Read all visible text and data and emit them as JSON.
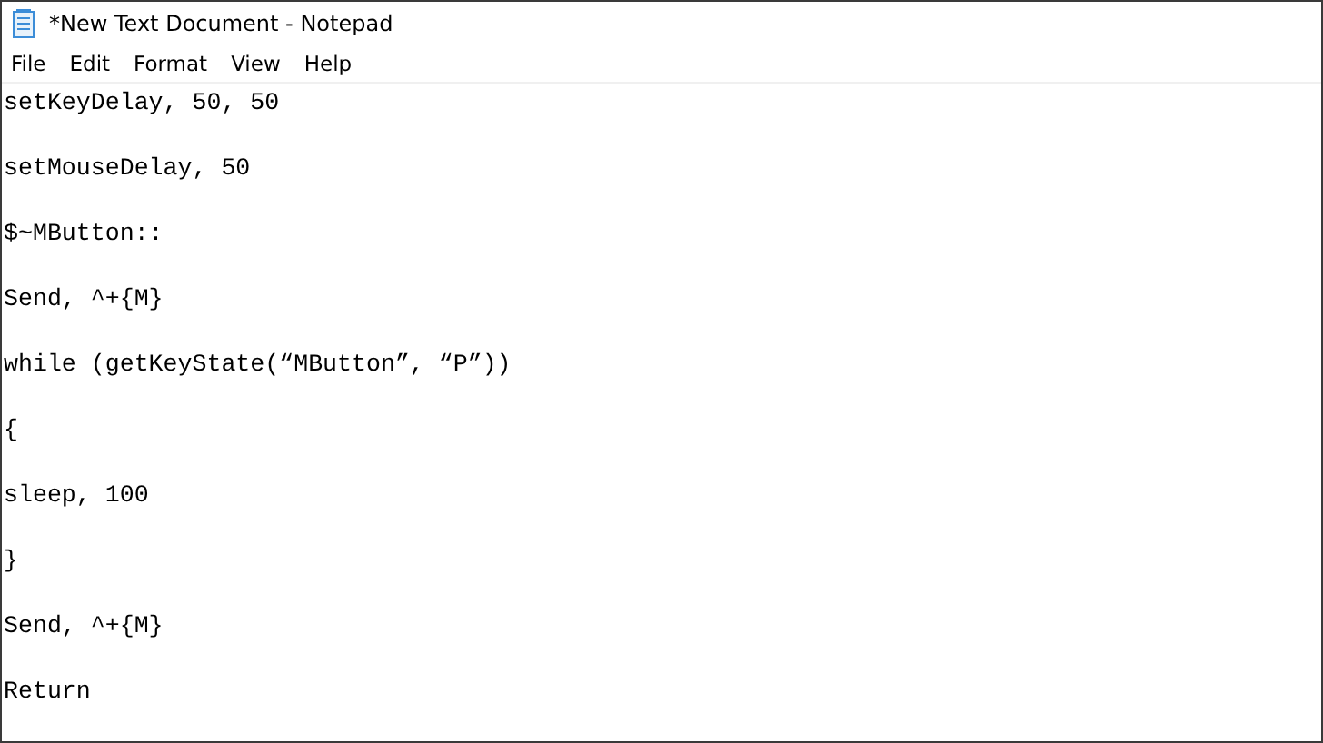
{
  "window": {
    "title": "*New Text Document - Notepad"
  },
  "menu": [
    "File",
    "Edit",
    "Format",
    "View",
    "Help"
  ],
  "editor": {
    "lines": [
      "setKeyDelay, 50, 50",
      "setMouseDelay, 50",
      "$~MButton::",
      "Send, ^+{M}",
      "while (getKeyState(“MButton”, “P”))",
      "{",
      "sleep, 100",
      "}",
      "Send, ^+{M}",
      "Return"
    ]
  }
}
